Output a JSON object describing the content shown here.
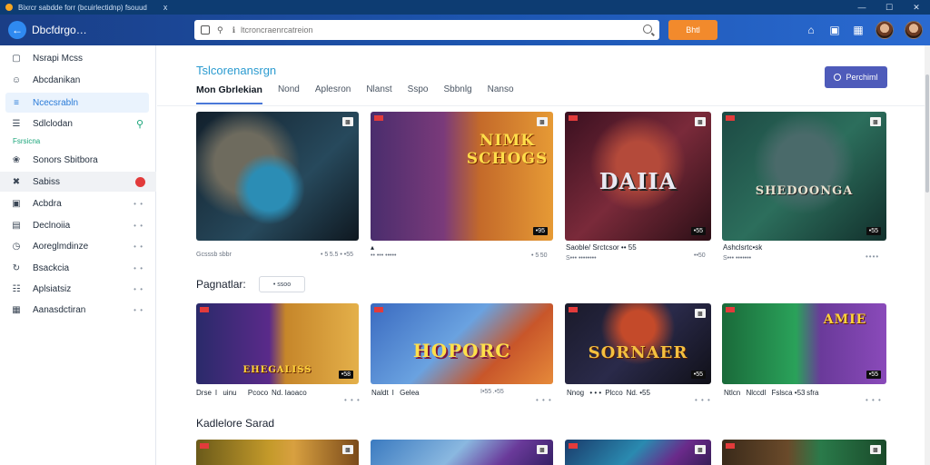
{
  "window": {
    "title": "Bixrcr sabdde forr (bcuirlectidnp) fsouud",
    "close_glyph": "x",
    "controls": [
      "—",
      "☐",
      "✕"
    ]
  },
  "header": {
    "brand": "Dbcfdrgo…",
    "search_placeholder": "ltcroncraenrcatreion",
    "orange_button": "Bhtl",
    "colors": {
      "accent": "#1d56b2",
      "orange": "#f28a2c"
    }
  },
  "sidebar": {
    "items": [
      {
        "label": "Nsrapi Mcss",
        "icon": "window-icon",
        "glyph": "▢"
      },
      {
        "label": "Abcdanikan",
        "icon": "user-icon",
        "glyph": "☺"
      },
      {
        "label": "Ncecsrabln",
        "icon": "dashboard-icon",
        "glyph": "≡",
        "active": true
      },
      {
        "label": "Sdlclodan",
        "icon": "list-icon",
        "glyph": "☰",
        "right_icon": "search-icon"
      },
      {
        "label": "Sonors Sbitbora",
        "icon": "ribbon-icon",
        "glyph": "❀"
      },
      {
        "label": "Sabiss",
        "icon": "tools-icon",
        "glyph": "✖",
        "badge": true,
        "hover": true
      },
      {
        "label": "Acbdra",
        "icon": "box-icon",
        "glyph": "▣"
      },
      {
        "label": "Declnoiia",
        "icon": "folder-icon",
        "glyph": "▤"
      },
      {
        "label": "Aoreglmdinze",
        "icon": "clock-icon",
        "glyph": "◷"
      },
      {
        "label": "Bsackcia",
        "icon": "sync-icon",
        "glyph": "↻"
      },
      {
        "label": "Aplsiatsiz",
        "icon": "document-icon",
        "glyph": "☷"
      },
      {
        "label": "Aanasdctiran",
        "icon": "grid-icon",
        "glyph": "▦"
      }
    ],
    "section_label": "Fsrsicna",
    "dots": "• •"
  },
  "main": {
    "title": "Tslcorenansrgn",
    "tabs": [
      "Mon Gbrlekian",
      "Nond",
      "Aplesron",
      "Nlanst",
      "Sspo",
      "Sbbnlg",
      "Nanso"
    ],
    "top_button": "Perchiml",
    "section2_title": "Pagnatlar:",
    "section2_pill": "• ssoo",
    "section3_title": "Kadlelore Sarad"
  },
  "row1": [
    {
      "logo": "",
      "count": "",
      "title": "Gcsssb sbbr",
      "sub": "",
      "right": "• 5 5.5 • •55",
      "dots": ""
    },
    {
      "logo": "NIMK SCHOGS",
      "count": "•95",
      "title": "▴",
      "sub": "•• ••• •••••",
      "right": "• 5 50",
      "dots": ""
    },
    {
      "logo": "DAIIA",
      "count": "•55",
      "title": "Saoble/ Srctcsor •• 55",
      "sub": "S••• ••••••••",
      "right": "••50",
      "dots": ""
    },
    {
      "logo": "SHEDOONGA",
      "count": "•55",
      "title": "Ashclsrtc•sk",
      "sub": "S••• •••••••",
      "right": "",
      "dots": "••••"
    }
  ],
  "row2": [
    {
      "logo": "EHEGALISS",
      "count": "•58",
      "title": "Drse I  uinu    Pcoco  Nd. Iaoaco",
      "dots": "• • •"
    },
    {
      "logo": "HOPORC",
      "count": "",
      "title": "Naldt I  Gelea",
      "right": "I•55 .•55",
      "dots": "• • •"
    },
    {
      "logo": "SORNAER",
      "count": "•55",
      "title": "Nnog  • • • Plcco  Nd. •55",
      "dots": "• • •"
    },
    {
      "logo": "AMIE",
      "count": "•55",
      "title": "Ntlcn  Nlccdl  Fslsca •53 sfra",
      "dots": "• • •"
    }
  ]
}
